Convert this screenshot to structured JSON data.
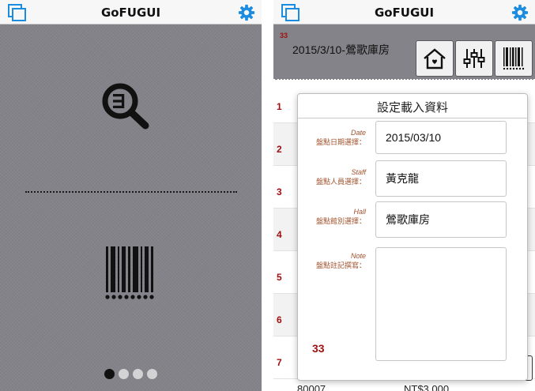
{
  "left_screen": {
    "nav": {
      "title": "GoFUGUI",
      "left_icon": "window-stack-icon",
      "right_icon": "gear-icon"
    },
    "icons": {
      "search": "search-icon",
      "barcode": "barcode-icon"
    },
    "pager": {
      "count": 4,
      "active": 0
    }
  },
  "right_screen": {
    "nav": {
      "title": "GoFUGUI",
      "left_icon": "window-stack-icon",
      "right_icon": "gear-icon"
    },
    "header": {
      "count": "33",
      "label": "2015/3/10-鶯歌庫房",
      "buttons": [
        "home-icon",
        "sliders-icon",
        "barcode-icon"
      ]
    },
    "list": {
      "row_numbers": [
        "1",
        "2",
        "3",
        "4",
        "5",
        "6",
        "7"
      ],
      "last_code": "80007",
      "last_price": "NT$3,000"
    },
    "popover": {
      "title": "設定載入資料",
      "fields": [
        {
          "label_en": "Date",
          "label_zh": "盤點日期選擇：",
          "value": "2015/03/10"
        },
        {
          "label_en": "Staff",
          "label_zh": "盤點人員選擇：",
          "value": "黃克龍"
        },
        {
          "label_en": "Hall",
          "label_zh": "盤點館別選擇：",
          "value": "鶯歌庫房"
        },
        {
          "label_en": "Note",
          "label_zh": "盤點註記撰寫：",
          "value": ""
        }
      ],
      "count": "33"
    }
  },
  "colors": {
    "accent_blue": "#1b8de0",
    "count_red": "#a01010",
    "label_brown": "#a0522d",
    "panel_gray": "#838389"
  }
}
